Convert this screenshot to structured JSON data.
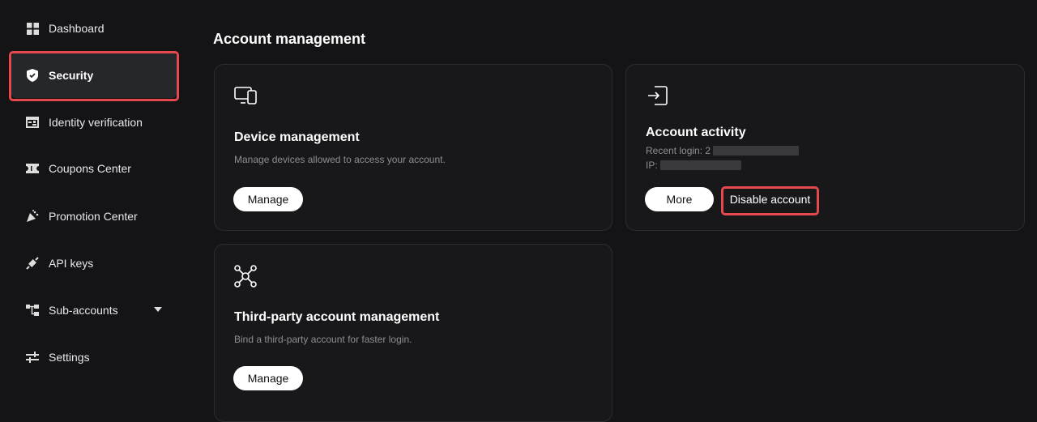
{
  "sidebar": {
    "items": [
      {
        "label": "Dashboard",
        "icon": "dashboard-icon"
      },
      {
        "label": "Security",
        "icon": "shield-icon",
        "active": true
      },
      {
        "label": "Identity verification",
        "icon": "id-card-icon"
      },
      {
        "label": "Coupons Center",
        "icon": "ticket-icon"
      },
      {
        "label": "Promotion Center",
        "icon": "party-popper-icon"
      },
      {
        "label": "API keys",
        "icon": "plug-icon"
      },
      {
        "label": "Sub-accounts",
        "icon": "hierarchy-icon"
      },
      {
        "label": "Settings",
        "icon": "sliders-icon"
      }
    ]
  },
  "main": {
    "title": "Account management",
    "device": {
      "title": "Device management",
      "desc": "Manage devices allowed to access your account.",
      "button": "Manage"
    },
    "activity": {
      "title": "Account activity",
      "recent_login_label": "Recent login: 2",
      "ip_label": "IP:",
      "more": "More",
      "disable": "Disable account"
    },
    "third_party": {
      "title": "Third-party account management",
      "desc": "Bind a third-party account for faster login.",
      "button": "Manage"
    }
  },
  "colors": {
    "highlight": "#e5484d",
    "background": "#141416",
    "card": "#18181b"
  }
}
